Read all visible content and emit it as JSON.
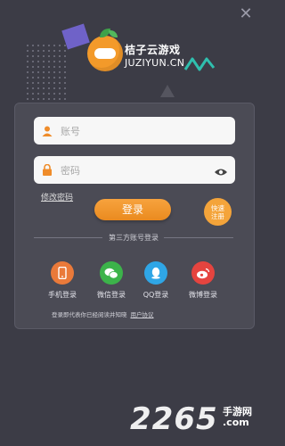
{
  "window": {
    "close_icon": "close-icon"
  },
  "logo": {
    "title": "桔子云游戏",
    "subtitle": "JUZIYUN.CN"
  },
  "login": {
    "account_placeholder": "账号",
    "password_placeholder": "密码",
    "forgot_password": "修改密码",
    "login_button": "登录",
    "quick_register_line1": "快速",
    "quick_register_line2": "注册"
  },
  "third_party": {
    "label": "第三方账号登录",
    "items": [
      {
        "label": "手机登录",
        "icon": "phone-icon",
        "color": "#ea7a3a"
      },
      {
        "label": "微信登录",
        "icon": "wechat-icon",
        "color": "#3cb34a"
      },
      {
        "label": "QQ登录",
        "icon": "qq-icon",
        "color": "#2fa6e6"
      },
      {
        "label": "微博登录",
        "icon": "weibo-icon",
        "color": "#e5443f"
      }
    ]
  },
  "agreement": {
    "text": "登录即代表你已经阅读并知晓",
    "link": "用户协议"
  },
  "watermark": {
    "number": "2265",
    "text1": "手游网",
    "text2": ".com"
  },
  "colors": {
    "background": "#3c3c46",
    "accent": "#f09a2e"
  }
}
